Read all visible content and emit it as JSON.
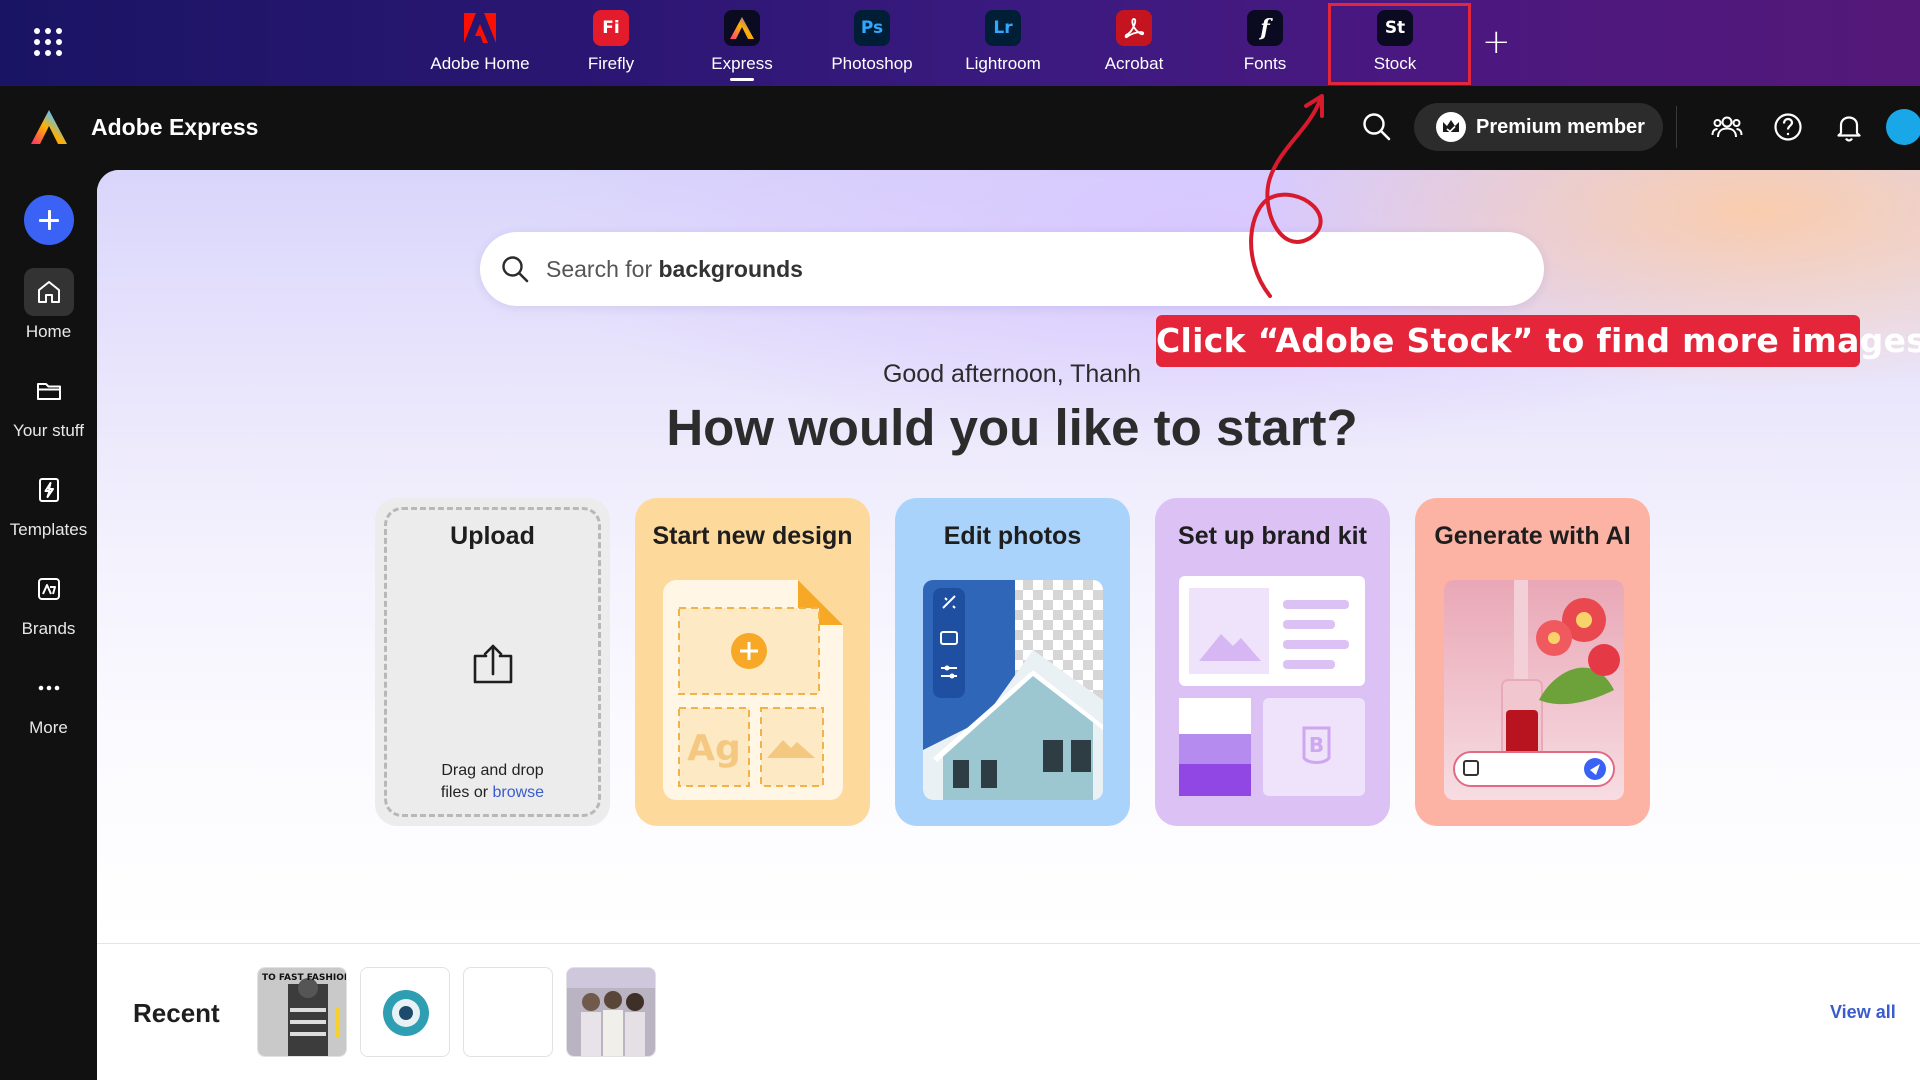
{
  "appbar": {
    "apps": [
      {
        "label": "Adobe Home",
        "icon": "adobe-logo-icon"
      },
      {
        "label": "Firefly",
        "icon_text": "Fi",
        "color": "#e31b2a"
      },
      {
        "label": "Express",
        "icon": "express-logo-icon",
        "active": true
      },
      {
        "label": "Photoshop",
        "icon_text": "Ps",
        "color": "#31a8ff"
      },
      {
        "label": "Lightroom",
        "icon_text": "Lr",
        "color": "#31a8ff"
      },
      {
        "label": "Acrobat",
        "icon": "acrobat-icon",
        "color": "#c4141f"
      },
      {
        "label": "Fonts",
        "icon_text": "f"
      },
      {
        "label": "Stock",
        "icon_text": "St"
      }
    ]
  },
  "header": {
    "brand": "Adobe Express",
    "premium_label": "Premium member"
  },
  "leftnav": {
    "items": [
      {
        "label": "Home",
        "icon": "home-icon",
        "active": true
      },
      {
        "label": "Your stuff",
        "icon": "folder-icon"
      },
      {
        "label": "Templates",
        "icon": "templates-icon"
      },
      {
        "label": "Brands",
        "icon": "brands-icon"
      },
      {
        "label": "More",
        "icon": "more-icon"
      }
    ]
  },
  "main": {
    "search": {
      "prefix": "Search for",
      "keyword": "backgrounds"
    },
    "greeting": "Good afternoon, Thanh",
    "headline": "How would you like to start?",
    "cards": [
      {
        "title": "Upload",
        "color": "#ececec",
        "drop_line1": "Drag and drop",
        "drop_line2": "files or",
        "browse": "browse"
      },
      {
        "title": "Start new design",
        "color": "#fdd99b"
      },
      {
        "title": "Edit photos",
        "color": "#a9d3fb"
      },
      {
        "title": "Set up brand kit",
        "color": "#dcc1f5"
      },
      {
        "title": "Generate with AI",
        "color": "#fcb3a3"
      }
    ],
    "recent": {
      "title": "Recent",
      "view_all": "View all",
      "thumb_text": "TO FAST FASHION"
    }
  },
  "annotation": {
    "callout": "Click “Adobe Stock” to find more images",
    "color": "#e4253a"
  }
}
